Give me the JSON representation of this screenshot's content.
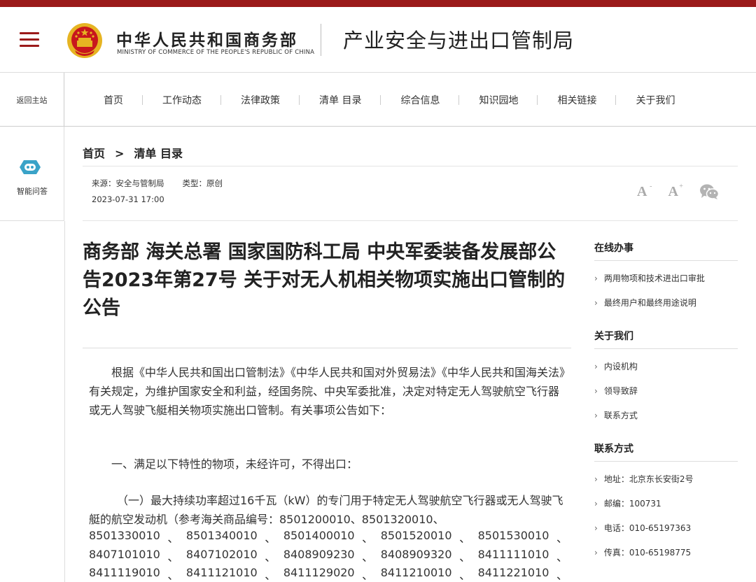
{
  "header": {
    "cn_name": "中华人民共和国商务部",
    "en_name": "MINISTRY OF COMMERCE OF THE PEOPLE'S REPUBLIC OF CHINA",
    "bureau": "产业安全与进出口管制局",
    "menu_icon": "hamburger-menu-icon",
    "emblem_icon": "national-emblem-icon"
  },
  "nav": {
    "back": "返回主站",
    "items": [
      "首页",
      "工作动态",
      "法律政策",
      "清单 目录",
      "综合信息",
      "知识园地",
      "相关链接",
      "关于我们"
    ]
  },
  "assistant": {
    "label": "智能问答",
    "icon": "robot-chat-icon"
  },
  "breadcrumb": {
    "home": "首页",
    "sep": ">",
    "current": "清单 目录"
  },
  "meta": {
    "source": "来源：安全与管制局",
    "type": "类型：原创",
    "date": "2023-07-31 17:00",
    "font_small": "A",
    "font_small_sup": "-",
    "font_large": "A",
    "font_large_sup": "+",
    "share_icon": "wechat-icon"
  },
  "article": {
    "title": "商务部 海关总署 国家国防科工局 中央军委装备发展部公告2023年第27号 关于对无人机相关物项实施出口管制的公告",
    "p1": "根据《中华人民共和国出口管制法》《中华人民共和国对外贸易法》《中华人民共和国海关法》有关规定，为维护国家安全和利益，经国务院、中央军委批准，决定对特定无人驾驶航空飞行器或无人驾驶飞艇相关物项实施出口管制。有关事项公告如下：",
    "p2": "一、满足以下特性的物项，未经许可，不得出口：",
    "p3": "（一）最大持续功率超过16千瓦（kW）的专门用于特定无人驾驶航空飞行器或无人驾驶飞艇的航空发动机（参考海关商品编号：8501200010、8501320010、",
    "code_rows": [
      [
        "8501330010",
        "、",
        "8501340010",
        "、",
        "8501400010",
        "、",
        "8501520010",
        "、",
        "8501530010",
        "、"
      ],
      [
        "8407101010",
        "、",
        "8407102010",
        "、",
        "8408909230",
        "、",
        "8408909320",
        "、",
        "8411111010",
        "、"
      ],
      [
        "8411119010",
        "、",
        "8411121010",
        "、",
        "8411129020",
        "、",
        "8411210010",
        "、",
        "8411221010",
        "、"
      ]
    ]
  },
  "sidebar": {
    "sections": [
      {
        "title": "在线办事",
        "items": [
          "两用物项和技术进出口审批",
          "最终用户和最终用途说明"
        ]
      },
      {
        "title": "关于我们",
        "items": [
          "内设机构",
          "领导致辞",
          "联系方式"
        ]
      },
      {
        "title": "联系方式",
        "items": [
          "地址：北京东长安街2号",
          "邮编：100731",
          "电话：010-65197363",
          "传真：010-65198775"
        ]
      }
    ],
    "chevron": "›"
  },
  "colors": {
    "brand_red": "#9b1a1a",
    "gold": "#e6b422"
  }
}
